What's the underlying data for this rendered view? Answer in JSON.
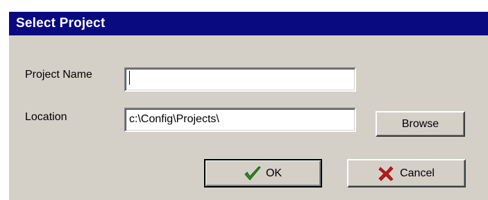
{
  "dialog": {
    "title": "Select Project",
    "project_name": {
      "label": "Project Name",
      "value": ""
    },
    "location": {
      "label": "Location",
      "value": "c:\\Config\\Projects\\"
    },
    "browse_label": "Browse",
    "ok": {
      "label": "OK",
      "icon": "checkmark-icon"
    },
    "cancel": {
      "label": "Cancel",
      "icon": "x-icon"
    }
  },
  "colors": {
    "titlebar": "#0a0a80",
    "dialog_face": "#d4d0c8",
    "ok_icon": "#2e8b1e",
    "cancel_icon": "#c01818"
  }
}
